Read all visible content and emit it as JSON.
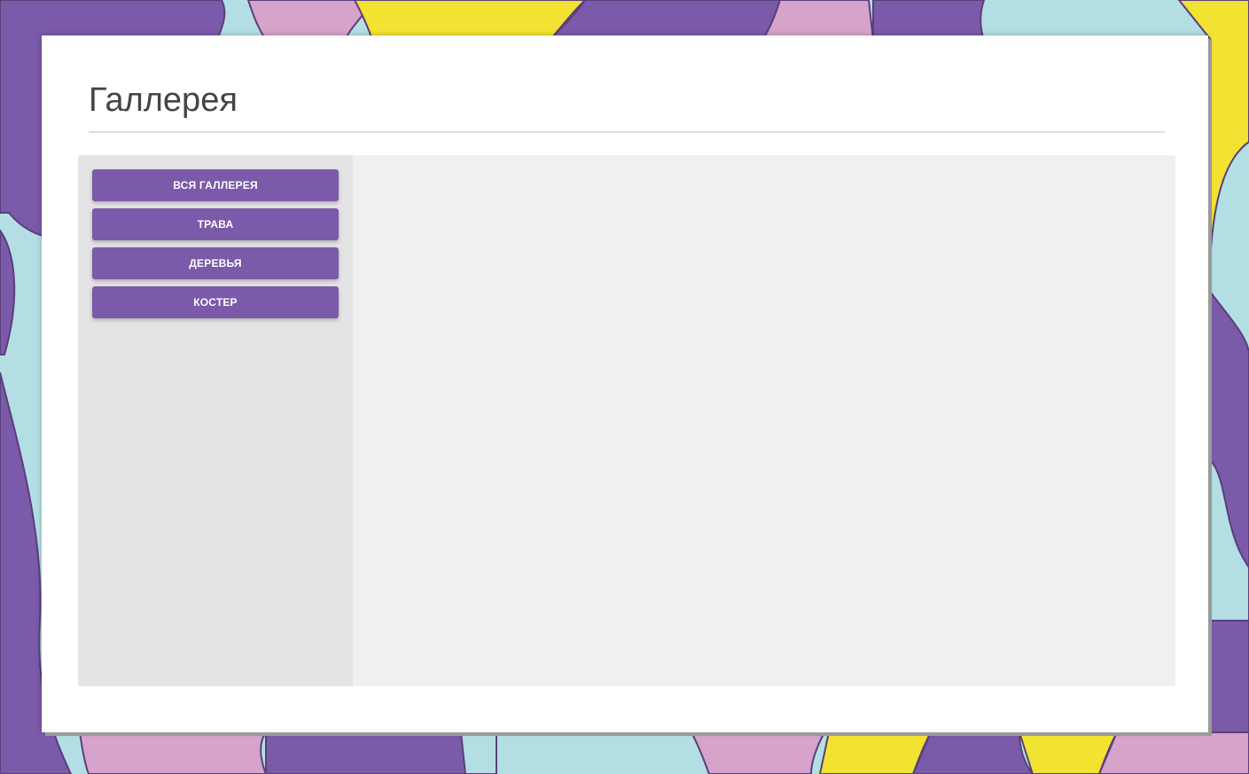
{
  "page": {
    "title": "Галлерея"
  },
  "sidebar": {
    "buttons": [
      {
        "label": "ВСЯ ГАЛЛЕРЕЯ"
      },
      {
        "label": "ТРАВА"
      },
      {
        "label": "ДЕРЕВЬЯ"
      },
      {
        "label": "КОСТЕР"
      }
    ]
  },
  "colors": {
    "accent": "#7b5aa9",
    "sidebar_bg": "#e4e4e4",
    "content_bg": "#f0f0f0",
    "title_text": "#444444",
    "background_palette": [
      "#b3dfe4",
      "#7b5aa9",
      "#d6a3cb",
      "#f2e232"
    ]
  }
}
